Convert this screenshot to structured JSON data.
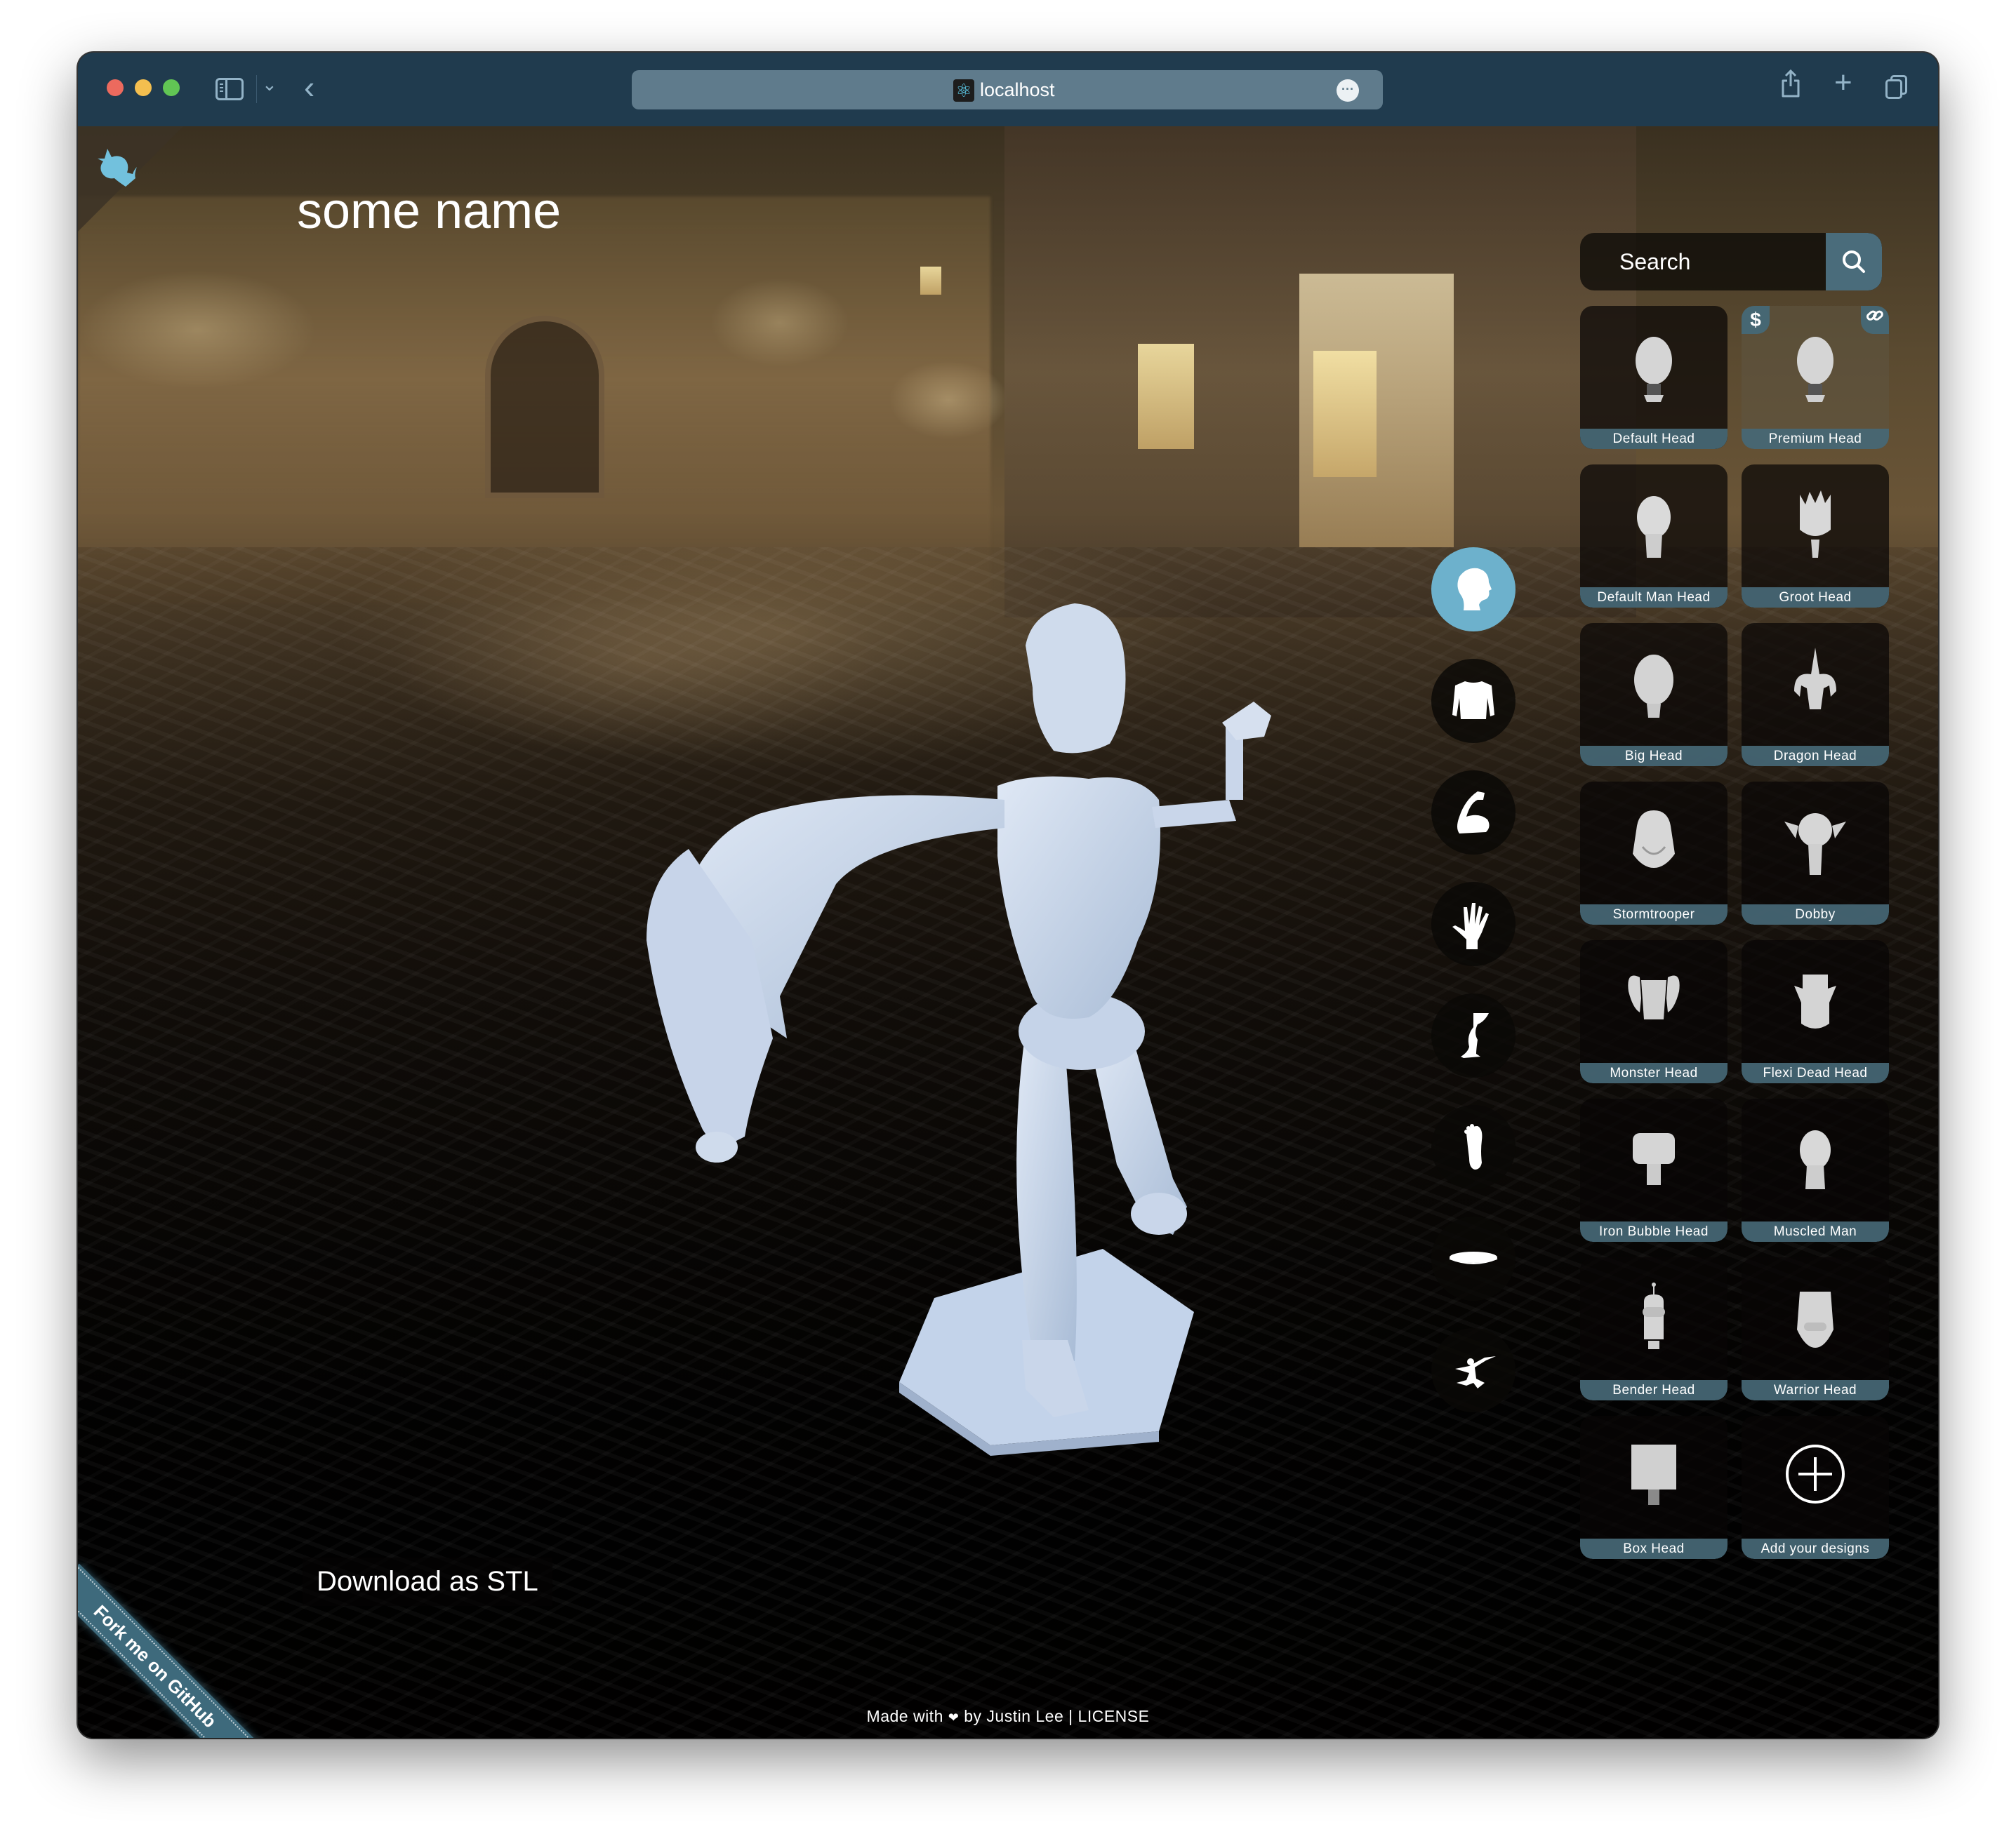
{
  "browser": {
    "url": "localhost",
    "favicon": "react-atom-icon",
    "toolbar_icons": [
      "sidebar-toggle-icon",
      "chevron-down-icon",
      "back-icon",
      "share-icon",
      "new-tab-icon",
      "tab-overview-icon"
    ]
  },
  "app": {
    "model_name": "some name",
    "download_label": "Download as STL",
    "fork_ribbon": "Fork me on GitHub",
    "footer": {
      "made_with": "Made with",
      "heart": "❤",
      "by": "by Justin Lee",
      "separator": "|",
      "license": "LICENSE"
    },
    "accent_color": "#6db1cc",
    "label_color": "#466876"
  },
  "part_categories": [
    {
      "name": "head",
      "active": true
    },
    {
      "name": "torso",
      "active": false
    },
    {
      "name": "arm",
      "active": false
    },
    {
      "name": "hand",
      "active": false
    },
    {
      "name": "leg",
      "active": false
    },
    {
      "name": "foot",
      "active": false
    },
    {
      "name": "stand",
      "active": false
    },
    {
      "name": "pose",
      "active": false
    }
  ],
  "search": {
    "placeholder": "Search"
  },
  "heads": [
    {
      "label": "Default Head"
    },
    {
      "label": "Premium Head",
      "price_badge": "$",
      "link_badge": "link"
    },
    {
      "label": "Default Man Head"
    },
    {
      "label": "Groot Head"
    },
    {
      "label": "Big Head"
    },
    {
      "label": "Dragon Head"
    },
    {
      "label": "Stormtrooper"
    },
    {
      "label": "Dobby"
    },
    {
      "label": "Monster Head"
    },
    {
      "label": "Flexi Dead Head"
    },
    {
      "label": "Iron Bubble Head"
    },
    {
      "label": "Muscled Man"
    },
    {
      "label": "Bender Head"
    },
    {
      "label": "Warrior Head"
    },
    {
      "label": "Box Head"
    },
    {
      "label": "Add your designs"
    }
  ]
}
